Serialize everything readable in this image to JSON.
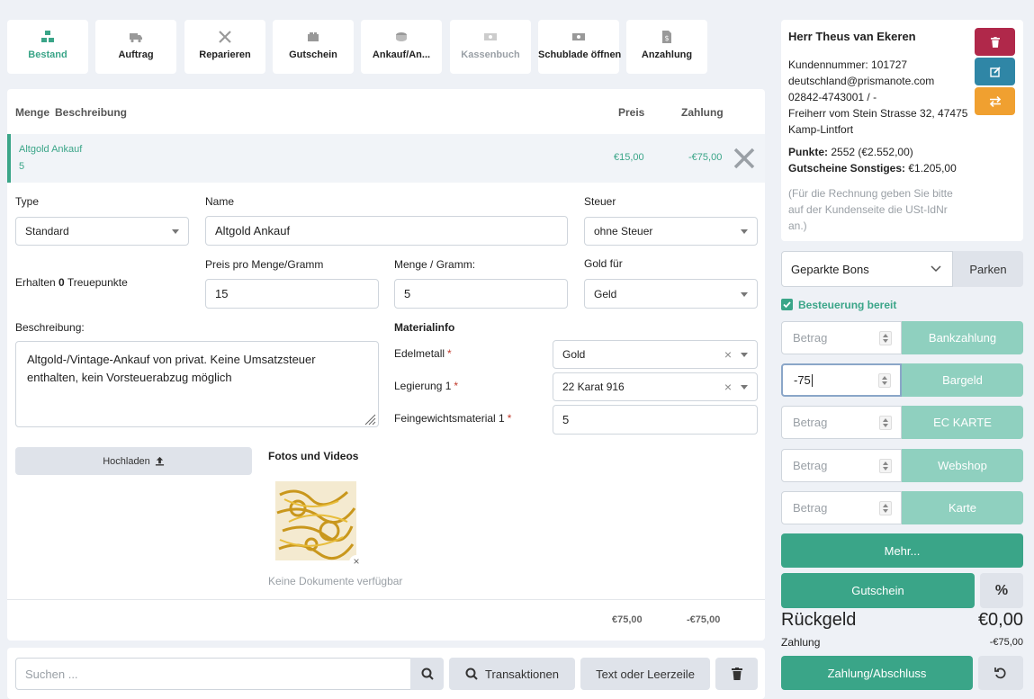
{
  "tiles": [
    {
      "label": "Bestand",
      "icon": "stock-icon"
    },
    {
      "label": "Auftrag",
      "icon": "truck-icon"
    },
    {
      "label": "Reparieren",
      "icon": "tools-icon"
    },
    {
      "label": "Gutschein",
      "icon": "voucher-icon"
    },
    {
      "label": "Ankauf/An...",
      "icon": "coins-icon"
    },
    {
      "label": "Kassenbuch",
      "icon": "cash-icon"
    },
    {
      "label": "Schublade öffnen",
      "icon": "drawer-icon"
    },
    {
      "label": "Anzahlung",
      "icon": "deposit-icon"
    }
  ],
  "table": {
    "col_menge": "Menge",
    "col_beschreibung": "Beschreibung",
    "col_preis": "Preis",
    "col_zahlung": "Zahlung",
    "row": {
      "name": "Altgold Ankauf",
      "qty": "5",
      "price": "€15,00",
      "payment": "-€75,00"
    }
  },
  "form": {
    "type_label": "Type",
    "type_value": "Standard",
    "name_label": "Name",
    "name_value": "Altgold Ankauf",
    "tax_label": "Steuer",
    "tax_value": "ohne Steuer",
    "loyalty_prefix": "Erhalten",
    "loyalty_points": "0",
    "loyalty_suffix": "Treuepunkte",
    "price_label": "Preis pro Menge/Gramm",
    "price_value": "15",
    "qty_label": "Menge / Gramm:",
    "qty_value": "5",
    "gold_label": "Gold für",
    "gold_value": "Geld",
    "desc_label": "Beschreibung:",
    "desc_value": "Altgold-/Vintage-Ankauf von privat. Keine Umsatzsteuer enthalten, kein Vorsteuerabzug möglich",
    "material_title": "Materialinfo",
    "edelmetall_label": "Edelmetall",
    "edelmetall_value": "Gold",
    "legierung_label": "Legierung 1",
    "legierung_value": "22 Karat 916",
    "feingewicht_label": "Feingewichtsmaterial 1",
    "feingewicht_value": "5",
    "upload_label": "Hochladen",
    "photos_title": "Fotos und Videos",
    "no_docs": "Keine Dokumente verfügbar"
  },
  "totals": {
    "price": "€75,00",
    "payment": "-€75,00"
  },
  "search": {
    "placeholder": "Suchen ...",
    "transactions": "Transaktionen",
    "text_line": "Text oder Leerzeile"
  },
  "customer": {
    "name": "Herr Theus van Ekeren",
    "number": "Kundennummer: 101727",
    "email": "deutschland@prismanote.com",
    "phone": "02842-4743001 / -",
    "street": "Freiherr vom Stein Strasse 32, 47475",
    "city": "Kamp-Lintfort",
    "points_label": "Punkte:",
    "points_value": "2552 (€2.552,00)",
    "vouchers_label": "Gutscheine Sonstiges:",
    "vouchers_value": "€1.205,00",
    "note": "(Für die Rechnung geben Sie bitte auf der Kundenseite die USt-IdNr an.)"
  },
  "parked": {
    "select": "Geparkte Bons",
    "button": "Parken"
  },
  "tax_ready": "Besteuerung bereit",
  "payments": [
    {
      "value": "",
      "placeholder": "Betrag",
      "label": "Bankzahlung"
    },
    {
      "value": "-75",
      "placeholder": "Betrag",
      "label": "Bargeld"
    },
    {
      "value": "",
      "placeholder": "Betrag",
      "label": "EC KARTE"
    },
    {
      "value": "",
      "placeholder": "Betrag",
      "label": "Webshop"
    },
    {
      "value": "",
      "placeholder": "Betrag",
      "label": "Karte"
    }
  ],
  "more": "Mehr...",
  "voucher_btn": "Gutschein",
  "percent": "%",
  "change_label": "Rückgeld",
  "change_value": "€0,00",
  "payment_label": "Zahlung",
  "payment_value": "-€75,00",
  "checkout": "Zahlung/Abschluss",
  "colors": {
    "accent": "#3aa588",
    "light_accent": "#8fd0bf",
    "danger": "#b0284a",
    "info": "#2f86a6",
    "warning": "#f0a030"
  }
}
